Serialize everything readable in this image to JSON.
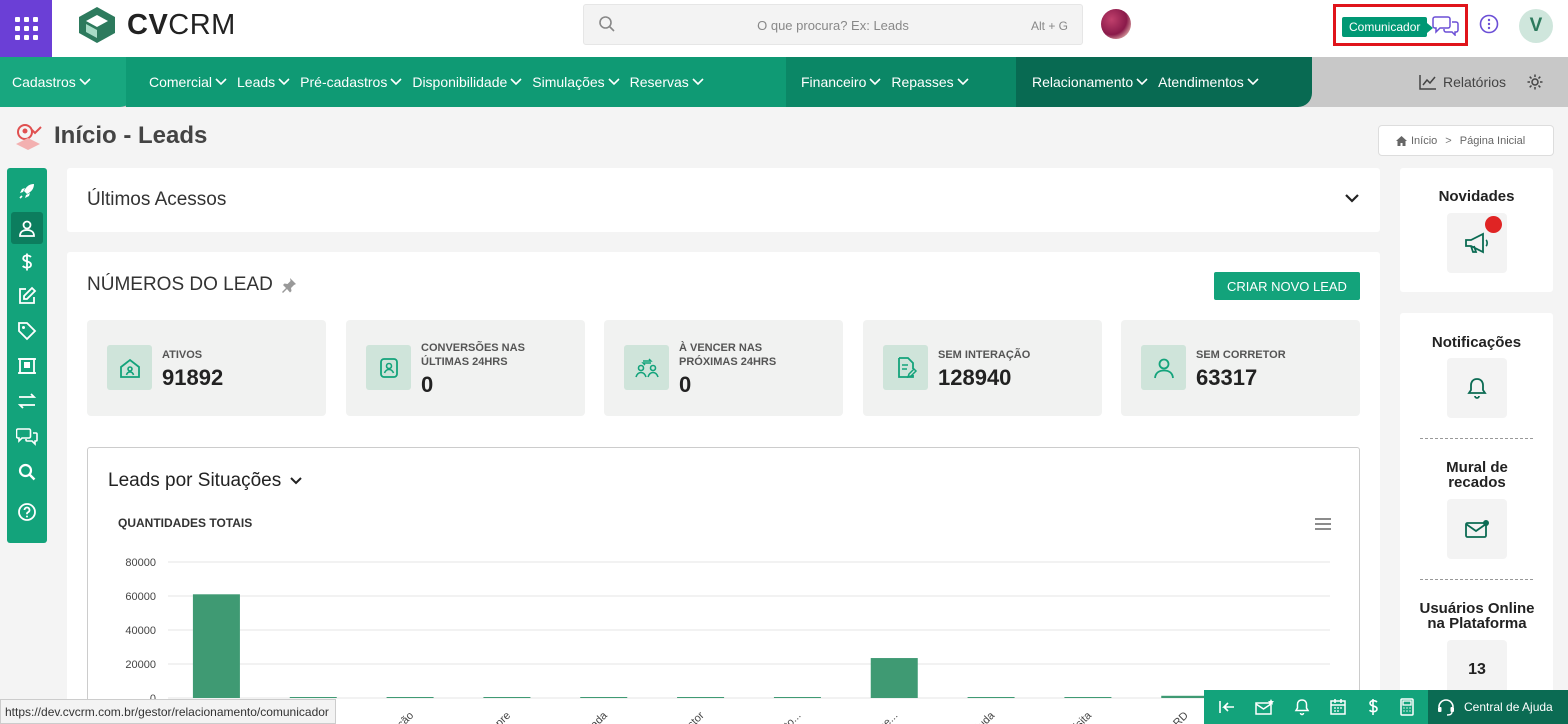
{
  "brand": {
    "name_bold": "CV",
    "name_light": "CRM"
  },
  "search": {
    "placeholder": "O que procura? Ex: Leads",
    "shortcut": "Alt + G"
  },
  "header": {
    "communicator_label": "Comunicador",
    "user_initial": "V"
  },
  "nav": {
    "items": [
      "Cadastros",
      "Comercial",
      "Leads",
      "Pré-cadastros",
      "Disponibilidade",
      "Simulações",
      "Reservas",
      "Financeiro",
      "Repasses",
      "Relacionamento",
      "Atendimentos"
    ],
    "reports_label": "Relatórios"
  },
  "page": {
    "title": "Início - Leads",
    "breadcrumb_home": "Início",
    "breadcrumb_current": "Página Inicial"
  },
  "last_access": {
    "title": "Últimos Acessos"
  },
  "lead_numbers": {
    "title": "NÚMEROS DO LEAD",
    "create_button": "CRIAR NOVO LEAD",
    "stats": [
      {
        "label": "ATIVOS",
        "value": "91892",
        "icon": "house-icon"
      },
      {
        "label": "CONVERSÕES NAS ÚLTIMAS 24HRS",
        "value": "0",
        "icon": "badge-user-icon"
      },
      {
        "label": "À VENCER NAS PRÓXIMAS 24HRS",
        "value": "0",
        "icon": "users-arrows-icon"
      },
      {
        "label": "SEM INTERAÇÃO",
        "value": "128940",
        "icon": "document-edit-icon"
      },
      {
        "label": "SEM CORRETOR",
        "value": "63317",
        "icon": "user-icon"
      }
    ]
  },
  "leads_chart_panel": {
    "title": "Leads por Situações",
    "subtitle": "QUANTIDADES TOTAIS"
  },
  "chart_data": {
    "type": "bar",
    "title": "QUANTIDADES TOTAIS",
    "ylim": [
      0,
      80000
    ],
    "yticks": [
      "80000",
      "60000",
      "40000",
      "20000",
      "0"
    ],
    "categories": [
      "",
      "",
      "...ação",
      "pre",
      "...elada",
      "...astor",
      "...nto...",
      "...me...",
      "...juda",
      "...visita",
      "...a RD",
      "...enda"
    ],
    "values": [
      61000,
      400,
      300,
      400,
      300,
      300,
      300,
      23500,
      300,
      300,
      1300,
      300
    ],
    "color": "#3f9a73"
  },
  "right_panel": {
    "news": "Novidades",
    "notifications": "Notificações",
    "board": "Mural de recados",
    "online_title": "Usuários Online na Plataforma",
    "online_count": "13"
  },
  "footer": {
    "status_url": "https://dev.cvcrm.com.br/gestor/relacionamento/comunicador",
    "help_label": "Central de Ajuda"
  }
}
